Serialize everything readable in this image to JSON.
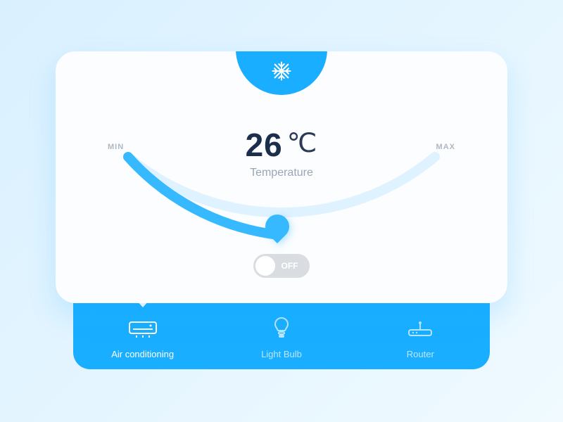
{
  "card": {
    "temperature_value": "26",
    "temperature_unit": "℃",
    "temperature_label": "Temperature",
    "min_label": "MIN",
    "max_label": "MAX",
    "toggle_state": "OFF"
  },
  "tray": {
    "items": [
      {
        "label": "Air conditioning"
      },
      {
        "label": "Light Bulb"
      },
      {
        "label": "Router"
      }
    ]
  }
}
